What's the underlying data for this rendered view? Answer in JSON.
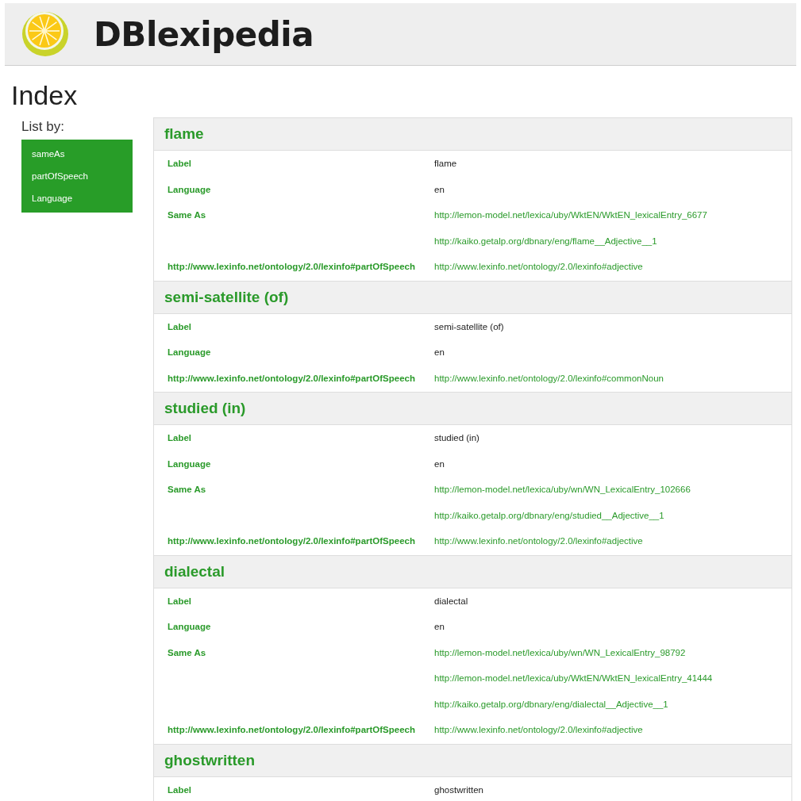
{
  "header": {
    "title": "DBlexipedia"
  },
  "page_title": "Index",
  "sidebar": {
    "heading": "List by:",
    "items": [
      {
        "label": "sameAs"
      },
      {
        "label": "partOfSpeech"
      },
      {
        "label": "Language"
      }
    ]
  },
  "entries": [
    {
      "title": "flame",
      "rows": [
        {
          "label": "Label",
          "value": "flame",
          "kind": "text"
        },
        {
          "label": "Language",
          "value": "en",
          "kind": "text"
        },
        {
          "label": "Same As",
          "value": "http://lemon-model.net/lexica/uby/WktEN/WktEN_lexicalEntry_6677",
          "kind": "link"
        },
        {
          "value": "http://kaiko.getalp.org/dbnary/eng/flame__Adjective__1",
          "kind": "link"
        },
        {
          "label": "http://www.lexinfo.net/ontology/2.0/lexinfo#partOfSpeech",
          "value": "http://www.lexinfo.net/ontology/2.0/lexinfo#adjective",
          "kind": "link"
        }
      ]
    },
    {
      "title": "semi-satellite (of)",
      "rows": [
        {
          "label": "Label",
          "value": "semi-satellite (of)",
          "kind": "text"
        },
        {
          "label": "Language",
          "value": "en",
          "kind": "text"
        },
        {
          "label": "http://www.lexinfo.net/ontology/2.0/lexinfo#partOfSpeech",
          "value": "http://www.lexinfo.net/ontology/2.0/lexinfo#commonNoun",
          "kind": "link"
        }
      ]
    },
    {
      "title": "studied (in)",
      "rows": [
        {
          "label": "Label",
          "value": "studied (in)",
          "kind": "text"
        },
        {
          "label": "Language",
          "value": "en",
          "kind": "text"
        },
        {
          "label": "Same As",
          "value": "http://lemon-model.net/lexica/uby/wn/WN_LexicalEntry_102666",
          "kind": "link"
        },
        {
          "value": "http://kaiko.getalp.org/dbnary/eng/studied__Adjective__1",
          "kind": "link"
        },
        {
          "label": "http://www.lexinfo.net/ontology/2.0/lexinfo#partOfSpeech",
          "value": "http://www.lexinfo.net/ontology/2.0/lexinfo#adjective",
          "kind": "link"
        }
      ]
    },
    {
      "title": "dialectal",
      "rows": [
        {
          "label": "Label",
          "value": "dialectal",
          "kind": "text"
        },
        {
          "label": "Language",
          "value": "en",
          "kind": "text"
        },
        {
          "label": "Same As",
          "value": "http://lemon-model.net/lexica/uby/wn/WN_LexicalEntry_98792",
          "kind": "link"
        },
        {
          "value": "http://lemon-model.net/lexica/uby/WktEN/WktEN_lexicalEntry_41444",
          "kind": "link"
        },
        {
          "value": "http://kaiko.getalp.org/dbnary/eng/dialectal__Adjective__1",
          "kind": "link"
        },
        {
          "label": "http://www.lexinfo.net/ontology/2.0/lexinfo#partOfSpeech",
          "value": "http://www.lexinfo.net/ontology/2.0/lexinfo#adjective",
          "kind": "link"
        }
      ]
    },
    {
      "title": "ghostwritten",
      "rows": [
        {
          "label": "Label",
          "value": "ghostwritten",
          "kind": "text"
        }
      ]
    }
  ]
}
